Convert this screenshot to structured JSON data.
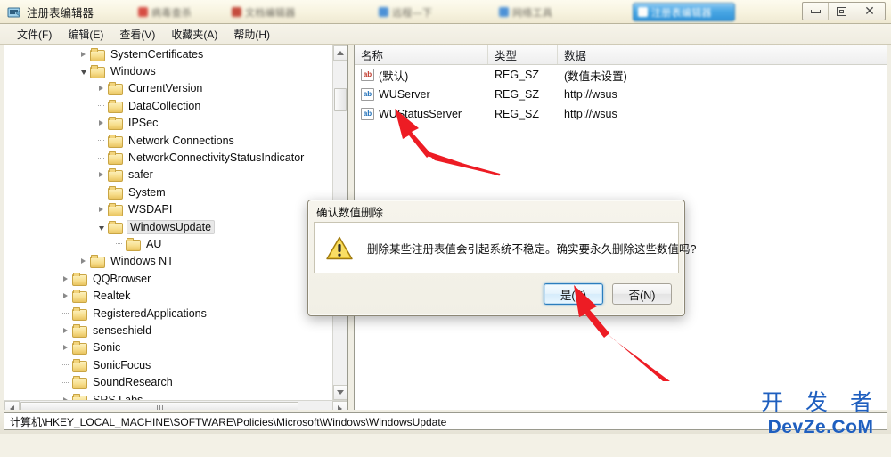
{
  "taskbar": {
    "items": [
      {
        "label": "病毒查杀",
        "color": "#d33a32",
        "active": false
      },
      {
        "label": "文档编辑器",
        "color": "#c0392b",
        "active": false
      },
      {
        "label": "远程—下",
        "color": "#3a87d6",
        "active": false
      },
      {
        "label": "网络工具",
        "color": "#3a87d6",
        "active": false
      },
      {
        "label": "注册表编辑器",
        "color": "#ffffff",
        "active": true
      }
    ],
    "controls": {
      "minimize": "minimize-icon",
      "maximize": "maximize-icon",
      "close": "close-icon"
    }
  },
  "window": {
    "title": "注册表编辑器",
    "icon": "registry-editor-icon"
  },
  "menu": {
    "items": [
      {
        "label": "文件(F)",
        "name": "menu-file"
      },
      {
        "label": "编辑(E)",
        "name": "menu-edit"
      },
      {
        "label": "查看(V)",
        "name": "menu-view"
      },
      {
        "label": "收藏夹(A)",
        "name": "menu-favorites"
      },
      {
        "label": "帮助(H)",
        "name": "menu-help"
      }
    ]
  },
  "tree": {
    "nodes": [
      {
        "label": "SystemCertificates",
        "indent": 4,
        "state": "closed",
        "selected": false
      },
      {
        "label": "Windows",
        "indent": 4,
        "state": "open",
        "selected": false
      },
      {
        "label": "CurrentVersion",
        "indent": 5,
        "state": "closed",
        "selected": false
      },
      {
        "label": "DataCollection",
        "indent": 5,
        "state": "leaf",
        "selected": false
      },
      {
        "label": "IPSec",
        "indent": 5,
        "state": "closed",
        "selected": false
      },
      {
        "label": "Network Connections",
        "indent": 5,
        "state": "leaf",
        "selected": false
      },
      {
        "label": "NetworkConnectivityStatusIndicator",
        "indent": 5,
        "state": "leaf",
        "selected": false
      },
      {
        "label": "safer",
        "indent": 5,
        "state": "closed",
        "selected": false
      },
      {
        "label": "System",
        "indent": 5,
        "state": "leaf",
        "selected": false
      },
      {
        "label": "WSDAPI",
        "indent": 5,
        "state": "closed",
        "selected": false
      },
      {
        "label": "WindowsUpdate",
        "indent": 5,
        "state": "open",
        "selected": true
      },
      {
        "label": "AU",
        "indent": 6,
        "state": "leaf",
        "selected": false
      },
      {
        "label": "Windows NT",
        "indent": 4,
        "state": "closed",
        "selected": false
      },
      {
        "label": "QQBrowser",
        "indent": 3,
        "state": "closed",
        "selected": false
      },
      {
        "label": "Realtek",
        "indent": 3,
        "state": "closed",
        "selected": false
      },
      {
        "label": "RegisteredApplications",
        "indent": 3,
        "state": "leaf",
        "selected": false
      },
      {
        "label": "senseshield",
        "indent": 3,
        "state": "closed",
        "selected": false
      },
      {
        "label": "Sonic",
        "indent": 3,
        "state": "closed",
        "selected": false
      },
      {
        "label": "SonicFocus",
        "indent": 3,
        "state": "leaf",
        "selected": false
      },
      {
        "label": "SoundResearch",
        "indent": 3,
        "state": "leaf",
        "selected": false
      },
      {
        "label": "SRS Labs",
        "indent": 3,
        "state": "closed",
        "selected": false
      }
    ]
  },
  "list": {
    "columns": [
      {
        "label": "名称",
        "name": "column-name"
      },
      {
        "label": "类型",
        "name": "column-type"
      },
      {
        "label": "数据",
        "name": "column-data"
      }
    ],
    "rows": [
      {
        "name": "(默认)",
        "type": "REG_SZ",
        "data": "(数值未设置)",
        "icon": "string-value-icon-red"
      },
      {
        "name": "WUServer",
        "type": "REG_SZ",
        "data": "http://wsus",
        "icon": "string-value-icon-blue"
      },
      {
        "name": "WUStatusServer",
        "type": "REG_SZ",
        "data": "http://wsus",
        "icon": "string-value-icon-blue"
      }
    ],
    "icon_text": "ab"
  },
  "statusbar": {
    "path": "计算机\\HKEY_LOCAL_MACHINE\\SOFTWARE\\Policies\\Microsoft\\Windows\\WindowsUpdate"
  },
  "dialog": {
    "title": "确认数值删除",
    "icon": "warning-icon",
    "message": "删除某些注册表值会引起系统不稳定。确实要永久删除这些数值吗?",
    "yes_label": "是(Y)",
    "no_label": "否(N)"
  },
  "annotations": {
    "arrow_color": "#ed1c24",
    "arrows": [
      {
        "name": "arrow-to-wustatusserver",
        "target": "WUStatusServer"
      },
      {
        "name": "arrow-to-yes-button",
        "target": "是(Y)"
      }
    ]
  },
  "watermark": {
    "cn": "开 发 者",
    "en": "DevZe.CoM",
    "color": "#1f5fbf"
  }
}
